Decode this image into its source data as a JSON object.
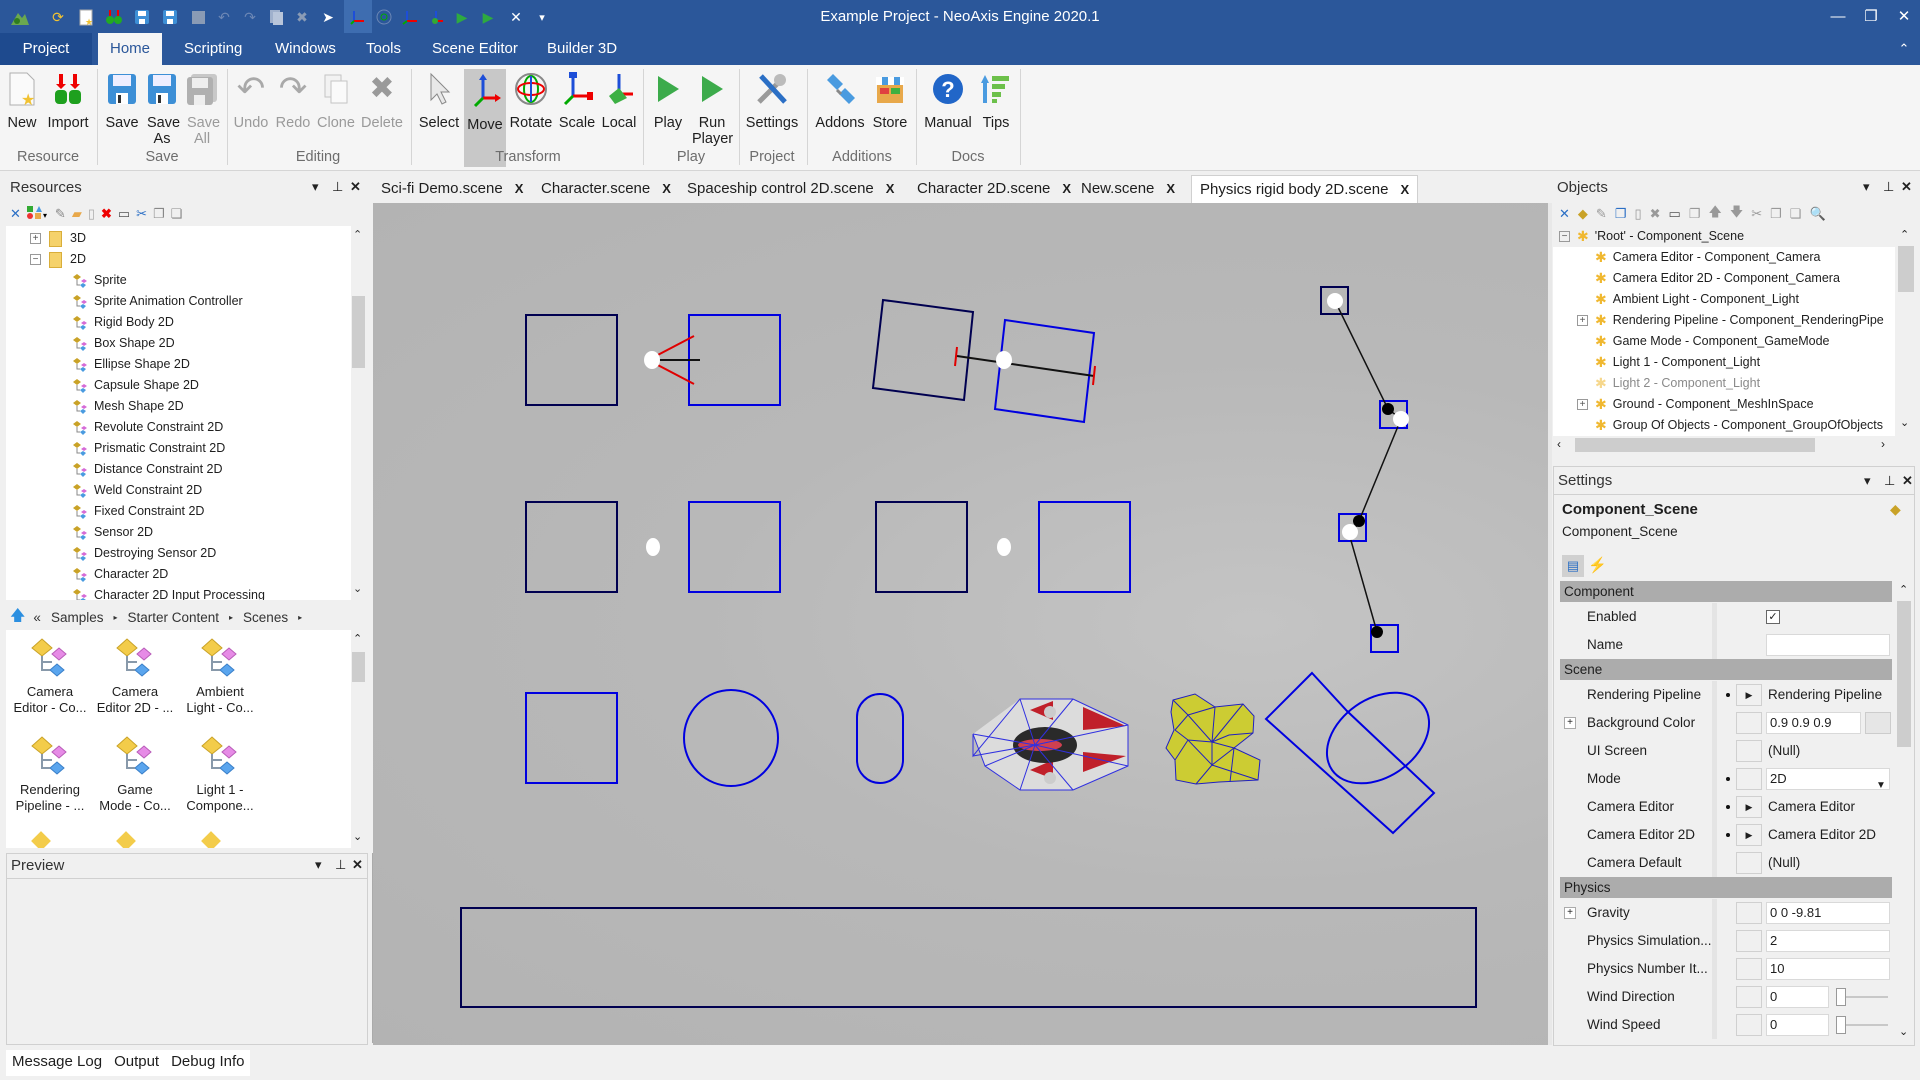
{
  "titlebar": {
    "title": "Example Project - NeoAxis Engine 2020.1",
    "quick_access_icons": [
      "app-logo-icon",
      "refresh-icon",
      "new-icon",
      "import-icon",
      "save-icon",
      "save-as-icon",
      "save-all-icon",
      "undo-icon",
      "redo-icon",
      "clone-icon",
      "delete-icon",
      "select-icon",
      "move-icon",
      "rotate-icon",
      "scale-icon",
      "local-icon",
      "play-icon",
      "run-player-icon",
      "settings-icon",
      "customize-dropdown-icon"
    ],
    "window_controls": {
      "minimize": "—",
      "restore": "❐",
      "close": "✕",
      "collapse_ribbon": "⌃"
    }
  },
  "ribbon_tabs": [
    {
      "label": "Project"
    },
    {
      "label": "Home",
      "active": true
    },
    {
      "label": "Scripting"
    },
    {
      "label": "Windows"
    },
    {
      "label": "Tools"
    },
    {
      "label": "Scene Editor"
    },
    {
      "label": "Builder 3D"
    }
  ],
  "ribbon": {
    "groups": [
      {
        "label": "Resource",
        "buttons": [
          {
            "label": "New",
            "icon": "new-file-icon"
          },
          {
            "label": "Import",
            "icon": "import-icon"
          }
        ]
      },
      {
        "label": "Save",
        "buttons": [
          {
            "label": "Save",
            "icon": "save-icon"
          },
          {
            "label": "Save As",
            "icon": "save-as-icon"
          },
          {
            "label": "Save All",
            "icon": "save-all-icon",
            "disabled": true
          }
        ]
      },
      {
        "label": "Editing",
        "buttons": [
          {
            "label": "Undo",
            "disabled": true
          },
          {
            "label": "Redo",
            "disabled": true
          },
          {
            "label": "Clone",
            "disabled": true
          },
          {
            "label": "Delete",
            "disabled": true
          }
        ]
      },
      {
        "label": "Transform",
        "buttons": [
          {
            "label": "Select"
          },
          {
            "label": "Move",
            "selected": true
          },
          {
            "label": "Rotate"
          },
          {
            "label": "Scale"
          },
          {
            "label": "Local"
          }
        ]
      },
      {
        "label": "Play",
        "buttons": [
          {
            "label": "Play"
          },
          {
            "label": "Run Player"
          }
        ]
      },
      {
        "label": "Project",
        "buttons": [
          {
            "label": "Settings"
          }
        ]
      },
      {
        "label": "Additions",
        "buttons": [
          {
            "label": "Addons"
          },
          {
            "label": "Store"
          }
        ]
      },
      {
        "label": "Docs",
        "buttons": [
          {
            "label": "Manual"
          },
          {
            "label": "Tips"
          }
        ]
      }
    ]
  },
  "resources": {
    "title": "Resources",
    "tree": [
      {
        "label": "3D",
        "type": "folder",
        "expanded": false
      },
      {
        "label": "2D",
        "type": "folder",
        "expanded": true
      },
      {
        "label": "Sprite"
      },
      {
        "label": "Sprite Animation Controller"
      },
      {
        "label": "Rigid Body 2D"
      },
      {
        "label": "Box Shape 2D"
      },
      {
        "label": "Ellipse Shape 2D"
      },
      {
        "label": "Capsule Shape 2D"
      },
      {
        "label": "Mesh Shape 2D"
      },
      {
        "label": "Revolute Constraint 2D"
      },
      {
        "label": "Prismatic Constraint 2D"
      },
      {
        "label": "Distance Constraint 2D"
      },
      {
        "label": "Weld Constraint 2D"
      },
      {
        "label": "Fixed Constraint 2D"
      },
      {
        "label": "Sensor 2D"
      },
      {
        "label": "Destroying Sensor 2D"
      },
      {
        "label": "Character 2D"
      },
      {
        "label": "Character 2D Input Processing"
      }
    ],
    "breadcrumb": [
      "Samples",
      "Starter Content",
      "Scenes"
    ],
    "grid_items": [
      {
        "line1": "Camera",
        "line2": "Editor - Co..."
      },
      {
        "line1": "Camera",
        "line2": "Editor 2D - ..."
      },
      {
        "line1": "Ambient",
        "line2": "Light - Co..."
      },
      {
        "line1": "Rendering",
        "line2": "Pipeline - ..."
      },
      {
        "line1": "Game",
        "line2": "Mode - Co..."
      },
      {
        "line1": "Light 1 -",
        "line2": "Compone..."
      }
    ]
  },
  "preview": {
    "title": "Preview"
  },
  "bottom_tabs": [
    "Message Log",
    "Output",
    "Debug Info"
  ],
  "document_tabs": [
    {
      "label": "Sci-fi Demo.scene"
    },
    {
      "label": "Character.scene"
    },
    {
      "label": "Spaceship control 2D.scene"
    },
    {
      "label": "Character 2D.scene"
    },
    {
      "label": "New.scene"
    },
    {
      "label": "Physics rigid body 2D.scene",
      "active": true
    }
  ],
  "objects": {
    "title": "Objects",
    "items": [
      {
        "label": "'Root' - Component_Scene",
        "level": 0,
        "expander": "minus",
        "selected": true
      },
      {
        "label": "Camera Editor - Component_Camera",
        "level": 1
      },
      {
        "label": "Camera Editor 2D - Component_Camera",
        "level": 1
      },
      {
        "label": "Ambient Light - Component_Light",
        "level": 1
      },
      {
        "label": "Rendering Pipeline - Component_RenderingPipe",
        "level": 1,
        "expander": "plus"
      },
      {
        "label": "Game Mode - Component_GameMode",
        "level": 1
      },
      {
        "label": "Light 1 - Component_Light",
        "level": 1
      },
      {
        "label": "Light 2 - Component_Light",
        "level": 1,
        "disabled": true
      },
      {
        "label": "Ground - Component_MeshInSpace",
        "level": 1,
        "expander": "plus"
      },
      {
        "label": "Group Of Objects - Component_GroupOfObjects",
        "level": 1
      }
    ]
  },
  "settings": {
    "title": "Settings",
    "object_name": "Component_Scene",
    "object_type": "Component_Scene",
    "categories": [
      {
        "name": "Component",
        "props": [
          {
            "label": "Enabled",
            "kind": "checkbox",
            "value": true
          },
          {
            "label": "Name",
            "kind": "text",
            "value": ""
          }
        ]
      },
      {
        "name": "Scene",
        "props": [
          {
            "label": "Rendering Pipeline",
            "kind": "ref",
            "value": "Rendering Pipeline",
            "dot": true
          },
          {
            "label": "Background Color",
            "kind": "color",
            "value": "0.9 0.9 0.9",
            "expandable": true,
            "swatch": "#e6e6e6"
          },
          {
            "label": "UI Screen",
            "kind": "ref-null",
            "value": "(Null)"
          },
          {
            "label": "Mode",
            "kind": "dropdown",
            "value": "2D",
            "dot": true
          },
          {
            "label": "Camera Editor",
            "kind": "ref",
            "value": "Camera Editor",
            "dot": true
          },
          {
            "label": "Camera Editor 2D",
            "kind": "ref",
            "value": "Camera Editor 2D",
            "dot": true
          },
          {
            "label": "Camera Default",
            "kind": "ref-null",
            "value": "(Null)"
          }
        ]
      },
      {
        "name": "Physics",
        "props": [
          {
            "label": "Gravity",
            "kind": "text",
            "value": "0 0 -9.81",
            "expandable": true
          },
          {
            "label": "Physics Simulation...",
            "kind": "text",
            "value": "2"
          },
          {
            "label": "Physics Number It...",
            "kind": "text",
            "value": "10"
          },
          {
            "label": "Wind Direction",
            "kind": "slider",
            "value": "0",
            "fraction": 0
          },
          {
            "label": "Wind Speed",
            "kind": "slider",
            "value": "0",
            "fraction": 0
          }
        ]
      }
    ]
  },
  "colors": {
    "accent": "#2b579a",
    "viewport_bg": "#b8b8b8",
    "shape_blue": "#0000e0",
    "shape_dark": "#000050",
    "constraint_red": "#e00000",
    "mesh_yellow": "#cccc33"
  }
}
